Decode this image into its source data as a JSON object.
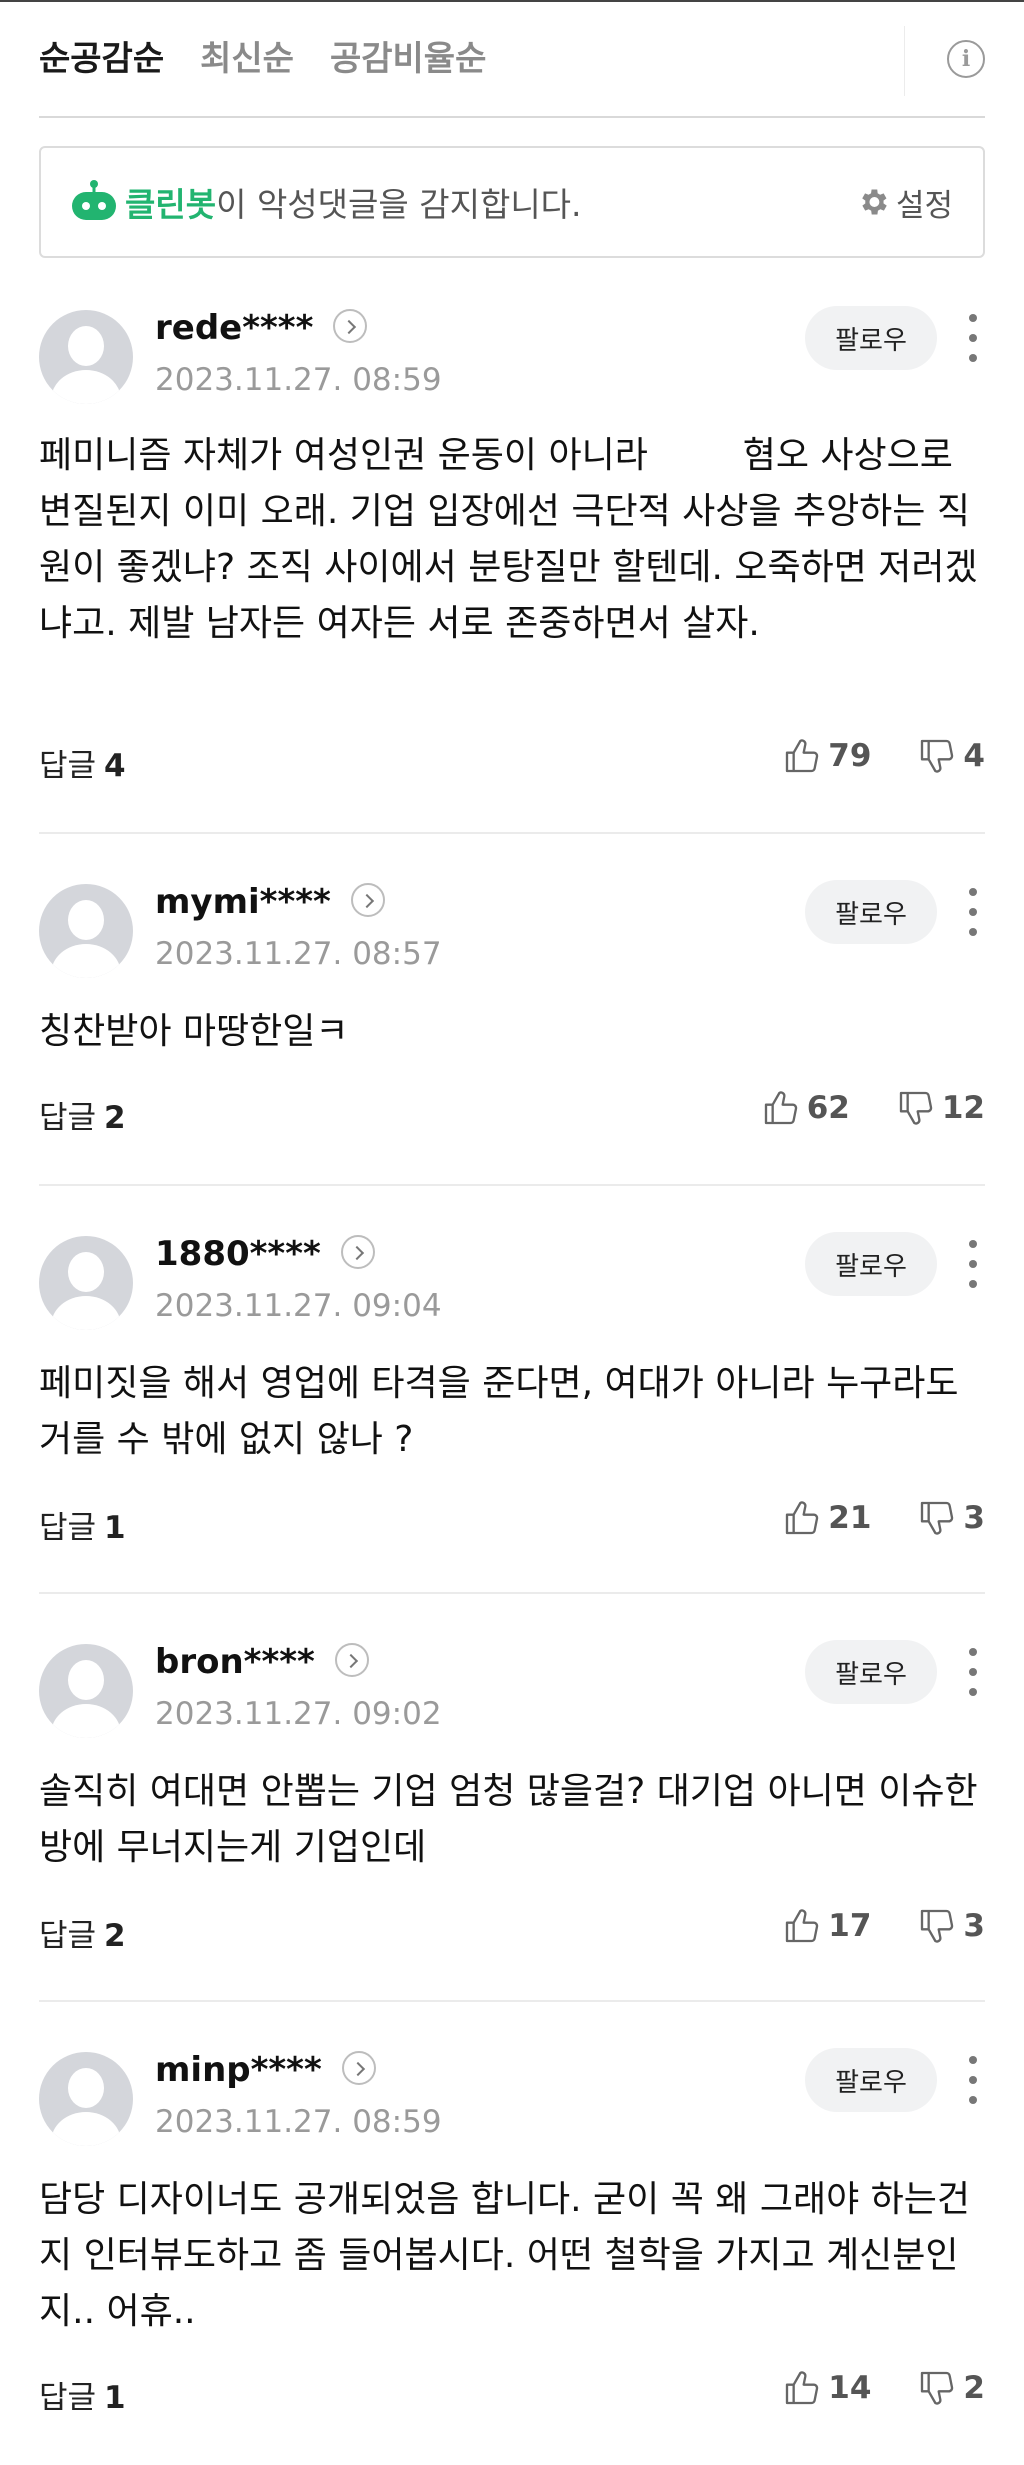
{
  "sort_tabs": [
    {
      "label": "순공감순",
      "active": true
    },
    {
      "label": "최신순",
      "active": false
    },
    {
      "label": "공감비율순",
      "active": false
    }
  ],
  "cleanbot": {
    "name": "클린봇",
    "message": "이 악성댓글을 감지합니다.",
    "settings_label": "설정"
  },
  "follow_label": "팔로우",
  "reply_label": "답글",
  "comments": [
    {
      "user": "rede****",
      "time": "2023.11.27. 08:59",
      "text": "페미니즘 자체가 여성인권 운동이 아니라 　　 혐오 사상으로 변질된지 이미 오래. 기업 입장에선 극단적 사상을 추앙하는 직원이 좋겠냐? 조직 사이에서 분탕질만 할텐데. 오죽하면 저러겠냐고. 제발 남자든 여자든 서로 존중하면서 살자.",
      "replies": "4",
      "likes": "79",
      "dislikes": "4"
    },
    {
      "user": "mymi****",
      "time": "2023.11.27. 08:57",
      "text": "칭찬받아 마땅한일ㅋ",
      "replies": "2",
      "likes": "62",
      "dislikes": "12"
    },
    {
      "user": "1880****",
      "time": "2023.11.27. 09:04",
      "text": "페미짓을 해서 영업에 타격을 준다면, 여대가 아니라 누구라도 거를 수 밖에 없지 않나 ?",
      "replies": "1",
      "likes": "21",
      "dislikes": "3"
    },
    {
      "user": "bron****",
      "time": "2023.11.27. 09:02",
      "text": "솔직히 여대면 안뽑는 기업 엄청 많을걸? 대기업 아니면 이슈한방에 무너지는게 기업인데",
      "replies": "2",
      "likes": "17",
      "dislikes": "3"
    },
    {
      "user": "minp****",
      "time": "2023.11.27. 08:59",
      "text": "담당 디자이너도 공개되었음 합니다. 굳이 꼭 왜 그래야 하는건지 인터뷰도하고 좀 들어봅시다. 어떤 철학을 가지고 계신분인지.. 어휴..",
      "replies": "1",
      "likes": "14",
      "dislikes": "2"
    }
  ],
  "colors": {
    "cleanbot_green": "#22b470",
    "muted_text": "#9a9a9a",
    "follow_bg": "#f1f2f3"
  },
  "icons": [
    "info-icon",
    "cleanbot-icon",
    "gear-icon",
    "chevron-right-icon",
    "more-vertical-icon",
    "thumbs-up-icon",
    "thumbs-down-icon"
  ]
}
